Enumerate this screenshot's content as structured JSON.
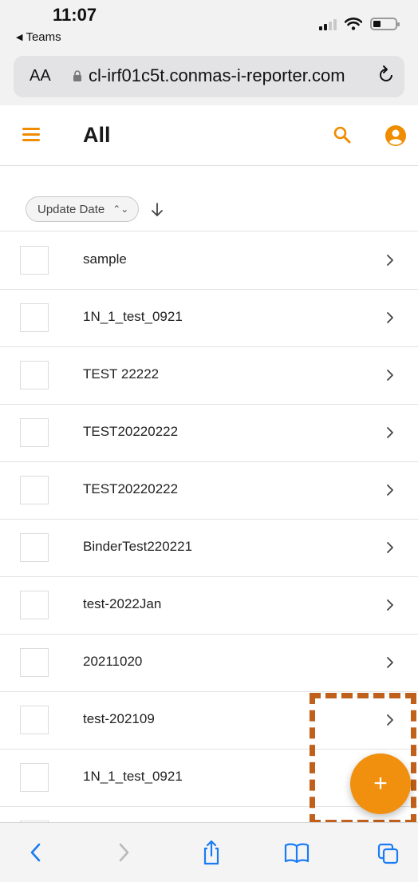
{
  "status_bar": {
    "time": "11:07",
    "back_app": "Teams"
  },
  "address_bar": {
    "text_size_label": "AA",
    "url": "cl-irf01c5t.conmas-i-reporter.com"
  },
  "header": {
    "title": "All"
  },
  "sort": {
    "label": "Update Date"
  },
  "items": [
    {
      "name": "sample"
    },
    {
      "name": "1N_1_test_0921"
    },
    {
      "name": "TEST 22222"
    },
    {
      "name": "TEST20220222"
    },
    {
      "name": "TEST20220222"
    },
    {
      "name": "BinderTest220221"
    },
    {
      "name": "test-2022Jan"
    },
    {
      "name": "20211020"
    },
    {
      "name": "test-202109"
    },
    {
      "name": "1N_1_test_0921"
    }
  ],
  "fab": {
    "label": "+"
  },
  "colors": {
    "accent": "#f08c00",
    "highlight": "#c0601a",
    "link_blue": "#1a7cf5"
  },
  "icons": {
    "menu": "hamburger-icon",
    "search": "search-icon",
    "account": "account-icon",
    "sort_direction": "arrow-down-icon",
    "row_chevron": "chevron-right-icon",
    "toolbar": [
      "back-icon",
      "forward-icon",
      "share-icon",
      "bookmarks-icon",
      "tabs-icon"
    ]
  }
}
